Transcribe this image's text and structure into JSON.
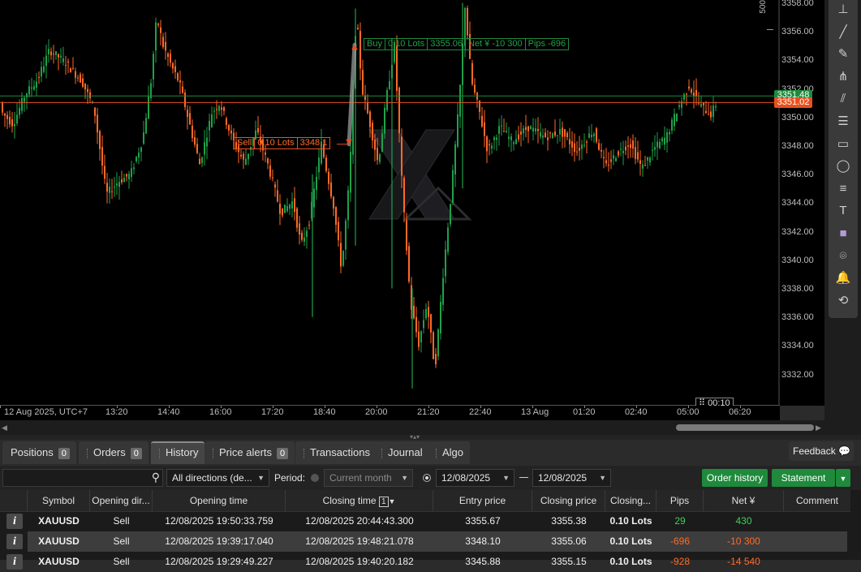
{
  "chart": {
    "price_ticks": [
      "3358.00",
      "3356.00",
      "3354.00",
      "3352.00",
      "3350.00",
      "3348.00",
      "3346.00",
      "3344.00",
      "3342.00",
      "3340.00",
      "3338.00",
      "3336.00",
      "3334.00",
      "3332.00"
    ],
    "time_ticks": [
      "12 Aug 2025, UTC+7",
      "13:20",
      "14:40",
      "16:00",
      "17:20",
      "18:40",
      "20:00",
      "21:20",
      "22:40",
      "13 Aug",
      "01:20",
      "02:40",
      "05:00",
      "06:20"
    ],
    "bid_badge": "3351.48",
    "ask_badge": "3351.02",
    "bid_color": "#1f8a3c",
    "ask_color": "#e8501e",
    "countdown": "00:10",
    "top_right_label": "500",
    "buy_label": [
      "Buy",
      "0.10 Lots",
      "3355.06",
      "Net ¥ -10 300",
      "Pips -696"
    ],
    "sell_label": [
      "Sell",
      "0.10 Lots",
      "3348.1"
    ],
    "bull_color": "#1fa14a",
    "bear_color": "#ff6a28"
  },
  "toolbar": {
    "icons": [
      "cursor-icon",
      "line-icon",
      "pen-icon",
      "pitchfork-icon",
      "parallel-lines-icon",
      "fibonacci-icon",
      "rectangle-icon",
      "ellipse-icon",
      "text-lines-icon",
      "text-icon",
      "color-swatch-icon",
      "camera-icon",
      "bell-icon",
      "replay-icon"
    ]
  },
  "tabs": [
    {
      "label": "Positions",
      "badge": "0"
    },
    {
      "label": "Orders",
      "badge": "0"
    },
    {
      "label": "History",
      "badge": ""
    },
    {
      "label": "Price alerts",
      "badge": "0"
    },
    {
      "label": "Transactions",
      "badge": ""
    },
    {
      "label": "Journal",
      "badge": ""
    },
    {
      "label": "Algo",
      "badge": ""
    }
  ],
  "feedback_label": "Feedback",
  "filters": {
    "direction": "All directions (de...",
    "period_label": "Period:",
    "period_value": "Current month",
    "date_from": "12/08/2025",
    "date_to": "12/08/2025",
    "order_history_btn": "Order history",
    "statement_btn": "Statement"
  },
  "table": {
    "columns": [
      "Symbol",
      "Opening dir...",
      "Opening time",
      "Closing time",
      "Entry price",
      "Closing price",
      "Closing...",
      "Pips",
      "Net ¥",
      "Comment"
    ],
    "sort_badge": "1",
    "rows": [
      [
        "XAUUSD",
        "Sell",
        "12/08/2025 19:50:33.759",
        "12/08/2025 20:44:43.300",
        "3355.67",
        "3355.38",
        "0.10 Lots",
        "29",
        "430",
        ""
      ],
      [
        "XAUUSD",
        "Sell",
        "12/08/2025 19:39:17.040",
        "12/08/2025 19:48:21.078",
        "3348.10",
        "3355.06",
        "0.10 Lots",
        "-696",
        "-10 300",
        ""
      ],
      [
        "XAUUSD",
        "Sell",
        "12/08/2025 19:29:49.227",
        "12/08/2025 19:40:20.182",
        "3345.88",
        "3355.15",
        "0.10 Lots",
        "-928",
        "-14 540",
        ""
      ]
    ]
  }
}
